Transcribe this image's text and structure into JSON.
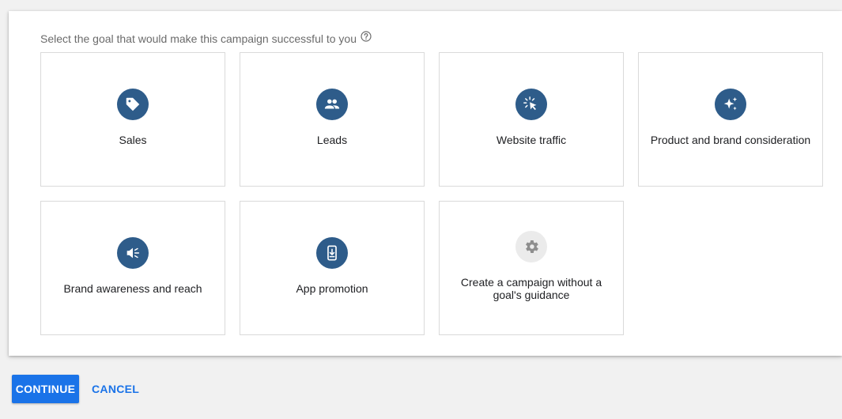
{
  "prompt": {
    "text": "Select the goal that would make this campaign successful to you",
    "help_icon": "help-circle-icon"
  },
  "goals": [
    {
      "label": "Sales",
      "icon": "tag-icon"
    },
    {
      "label": "Leads",
      "icon": "people-icon"
    },
    {
      "label": "Website traffic",
      "icon": "cursor-click-icon"
    },
    {
      "label": "Product and brand consideration",
      "icon": "sparkle-icon"
    },
    {
      "label": "Brand awareness and reach",
      "icon": "speaker-icon"
    },
    {
      "label": "App promotion",
      "icon": "phone-download-icon"
    },
    {
      "label": "Create a campaign without a goal's guidance",
      "icon": "gear-icon"
    }
  ],
  "actions": {
    "continue_label": "CONTINUE",
    "cancel_label": "CANCEL"
  },
  "colors": {
    "icon_circle": "#2e5c8a",
    "icon_circle_neutral": "#ebebeb",
    "primary": "#1a73e8"
  }
}
